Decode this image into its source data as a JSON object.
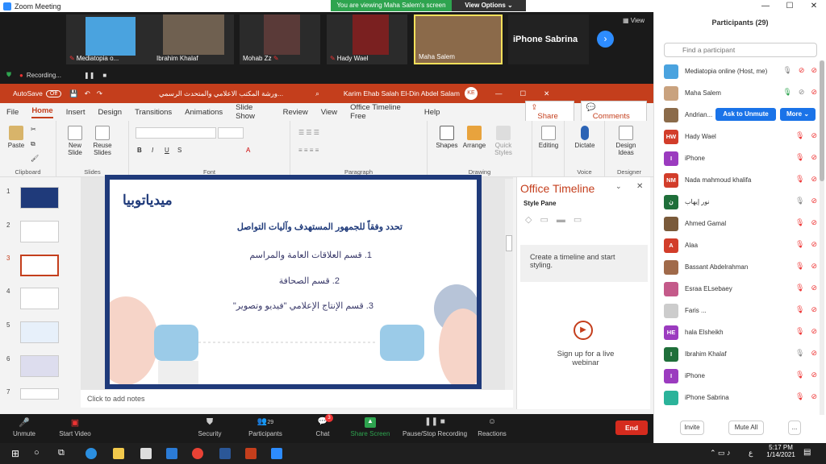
{
  "zoom": {
    "window_title": "Zoom Meeting",
    "viewing_banner": "You are viewing Maha Salem's screen",
    "view_options": "View Options",
    "view_label": "View",
    "recording_label": "Recording...",
    "videos": [
      {
        "name": "Mediatopia o..."
      },
      {
        "name": "Ibrahim Khalaf"
      },
      {
        "name": "Mohab Zz"
      },
      {
        "name": "Hady Wael"
      },
      {
        "name": "Maha Salem"
      },
      {
        "name": "iPhone Sabrina"
      }
    ],
    "toolbar": {
      "unmute": "Unmute",
      "start_video": "Start Video",
      "security": "Security",
      "participants": "Participants",
      "participants_count": "29",
      "chat": "Chat",
      "chat_badge": "3",
      "share_screen": "Share Screen",
      "pause_recording": "Pause/Stop Recording",
      "reactions": "Reactions",
      "end": "End"
    }
  },
  "ppt": {
    "autosave": "AutoSave",
    "autosave_state": "Off",
    "file_title": "ورشة المكتب الاعلامي والمتحدث الرسمي...",
    "user": "Karim Ehab Salah El-Din Abdel Salam",
    "user_initials": "KE",
    "menu": [
      "File",
      "Home",
      "Insert",
      "Design",
      "Transitions",
      "Animations",
      "Slide Show",
      "Review",
      "View",
      "Office Timeline Free",
      "Help"
    ],
    "share": "Share",
    "comments": "Comments",
    "groups": {
      "clipboard": "Clipboard",
      "slides": "Slides",
      "font": "Font",
      "paragraph": "Paragraph",
      "drawing": "Drawing",
      "voice": "Voice",
      "designer": "Designer"
    },
    "buttons": {
      "paste": "Paste",
      "new_slide": "New Slide",
      "reuse_slides": "Reuse Slides",
      "shapes": "Shapes",
      "arrange": "Arrange",
      "quick_styles": "Quick Styles",
      "editing": "Editing",
      "dictate": "Dictate",
      "design_ideas": "Design Ideas"
    },
    "slide_numbers": [
      "1",
      "2",
      "3",
      "4",
      "5",
      "6",
      "7"
    ],
    "notes_placeholder": "Click to add notes",
    "slide": {
      "logo": "ميدياتوبيا",
      "heading": "تحدد وفقاً للجمهور المستهدف وآليات التواصل",
      "items": [
        "1. قسم العلاقات العامة والمراسم",
        "2. قسم الصحافة",
        "3. قسم الإنتاج الإعلامي \"فيديو وتصوير\""
      ]
    },
    "office_timeline": {
      "title": "Office Timeline",
      "style_pane": "Style Pane",
      "create_text": "Create a timeline and start styling.",
      "signup": "Sign up for a live webinar"
    }
  },
  "participants_panel": {
    "title": "Participants (29)",
    "search_placeholder": "Find a participant",
    "list": [
      {
        "name": "Mediatopia online (Host, me)",
        "initials": "",
        "color": "#4aa3df"
      },
      {
        "name": "Maha Salem",
        "initials": "",
        "color": "#c9a27e"
      },
      {
        "name": "Andrian...",
        "initials": "",
        "color": "#8b6b4a"
      },
      {
        "name": "Hady Wael",
        "initials": "HW",
        "color": "#d23d2a"
      },
      {
        "name": "iPhone",
        "initials": "I",
        "color": "#9b3bbf"
      },
      {
        "name": "Nada mahmoud khalifa",
        "initials": "NM",
        "color": "#d23d2a"
      },
      {
        "name": "نور إيهاب",
        "initials": "ن",
        "color": "#1f6f3a"
      },
      {
        "name": "Ahmed Gamal",
        "initials": "",
        "color": "#7a5a3a"
      },
      {
        "name": "Alaa",
        "initials": "A",
        "color": "#d23d2a"
      },
      {
        "name": "Bassant Abdelrahman",
        "initials": "",
        "color": "#a06a4a"
      },
      {
        "name": "Esraa ELsebaey",
        "initials": "",
        "color": "#c45a8a"
      },
      {
        "name": "Faris ...",
        "initials": "",
        "color": "#cccccc"
      },
      {
        "name": "hala Elsheikh",
        "initials": "HE",
        "color": "#9b3bbf"
      },
      {
        "name": "Ibrahim Khalaf",
        "initials": "I",
        "color": "#1f6f3a"
      },
      {
        "name": "iPhone",
        "initials": "I",
        "color": "#9b3bbf"
      },
      {
        "name": "iPhone Sabrina",
        "initials": "",
        "color": "#2bb39a"
      }
    ],
    "ask_unmute": "Ask to Unmute",
    "more": "More",
    "invite": "Invite",
    "mute_all": "Mute All",
    "more_dots": "..."
  },
  "taskbar": {
    "time": "5:17 PM",
    "date": "1/14/2021",
    "lang": "ع"
  }
}
